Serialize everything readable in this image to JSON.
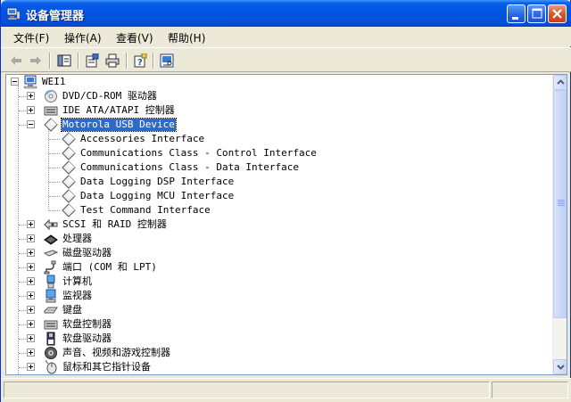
{
  "window": {
    "title": "设备管理器",
    "title_icon": "device-manager-icon",
    "buttons": [
      "minimize-icon",
      "maximize-icon",
      "close-icon"
    ]
  },
  "menu": [
    {
      "label": "文件(F)"
    },
    {
      "label": "操作(A)"
    },
    {
      "label": "查看(V)"
    },
    {
      "label": "帮助(H)"
    }
  ],
  "toolbar": {
    "items": [
      "back-arrow-icon",
      "forward-arrow-icon",
      "show-hide-console-tree-icon",
      "properties-icon",
      "print-icon",
      "help-icon",
      "scan-hardware-icon"
    ]
  },
  "tree": {
    "root": {
      "label": "WEI1",
      "icon": "computer-icon"
    },
    "nodes": [
      {
        "label": "DVD/CD-ROM 驱动器",
        "icon": "cdrom-icon",
        "expanded": false
      },
      {
        "label": "IDE ATA/ATAPI 控制器",
        "icon": "ide-controller-icon",
        "expanded": false
      },
      {
        "label": "Motorola USB Device",
        "icon": "usb-device-diamond-icon",
        "expanded": true,
        "selected": true,
        "children": [
          {
            "label": "Accessories Interface"
          },
          {
            "label": "Communications Class - Control Interface"
          },
          {
            "label": "Communications Class - Data Interface"
          },
          {
            "label": "Data Logging DSP Interface"
          },
          {
            "label": "Data Logging MCU Interface"
          },
          {
            "label": "Test Command Interface"
          }
        ]
      },
      {
        "label": "SCSI 和 RAID 控制器",
        "icon": "scsi-raid-icon",
        "expanded": false
      },
      {
        "label": "处理器",
        "icon": "processor-icon",
        "expanded": false
      },
      {
        "label": "磁盘驱动器",
        "icon": "disk-drive-icon",
        "expanded": false
      },
      {
        "label": "端口 (COM 和 LPT)",
        "icon": "port-icon",
        "expanded": false
      },
      {
        "label": "计算机",
        "icon": "computer-small-icon",
        "expanded": false
      },
      {
        "label": "监视器",
        "icon": "monitor-icon",
        "expanded": false
      },
      {
        "label": "键盘",
        "icon": "keyboard-icon",
        "expanded": false
      },
      {
        "label": "软盘控制器",
        "icon": "floppy-controller-icon",
        "expanded": false
      },
      {
        "label": "软盘驱动器",
        "icon": "floppy-drive-icon",
        "expanded": false
      },
      {
        "label": "声音、视频和游戏控制器",
        "icon": "sound-icon",
        "expanded": false
      },
      {
        "label": "鼠标和其它指针设备",
        "icon": "mouse-icon",
        "expanded": false
      }
    ]
  },
  "colors": {
    "titlebar": "#0054E3",
    "selection": "#316AC5",
    "window_bg": "#ECE9D8"
  }
}
